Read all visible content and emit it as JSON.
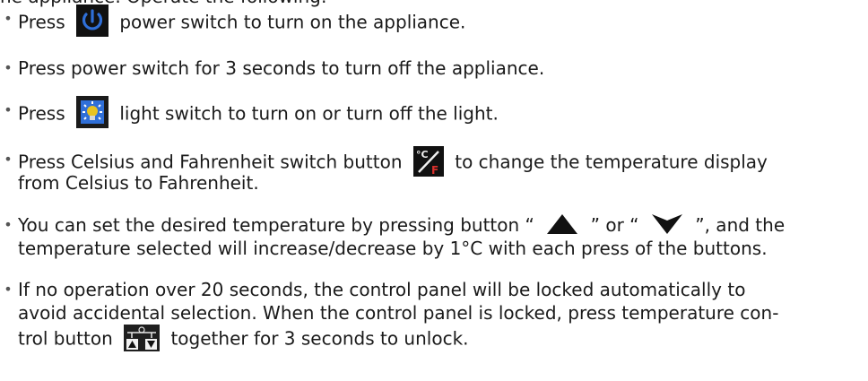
{
  "document": {
    "top_line": "he appliance. Operate the following:",
    "items": [
      {
        "a": "Press",
        "b": "power switch to turn on the appliance.",
        "icon": "power-icon"
      },
      {
        "a": "Press power switch for 3 seconds to turn off the appliance."
      },
      {
        "a": "Press",
        "b": "light switch to turn on or turn off the light.",
        "icon": "light-bulb-icon"
      },
      {
        "a": "Press Celsius and Fahrenheit switch button",
        "b": "to change the temperature display",
        "c": "from Celsius to Fahrenheit.",
        "icon": "celsius-fahrenheit-icon",
        "icon_label": "°C/F"
      },
      {
        "a": "You can set the desired temperature by pressing button “",
        "b": "” or “",
        "c": "”, and the",
        "d": "temperature selected will increase/decrease by 1°C with each press of the buttons.",
        "icons": [
          "up-arrow-icon",
          "down-arrow-icon"
        ]
      },
      {
        "a": "If no operation over 20 seconds, the control panel will be locked automatically to",
        "b": "avoid accidental selection. When the control panel is locked, press temperature con-",
        "c": "trol button",
        "d": "together for 3 seconds to unlock.",
        "icon": "lock-buttons-icon"
      }
    ],
    "bullet": "•"
  },
  "colors": {
    "text": "#1a1a1a",
    "icon_bg": "#111111",
    "icon_blue": "#2f6fd8",
    "icon_red": "#d9302c",
    "icon_yellow": "#e8c321"
  }
}
